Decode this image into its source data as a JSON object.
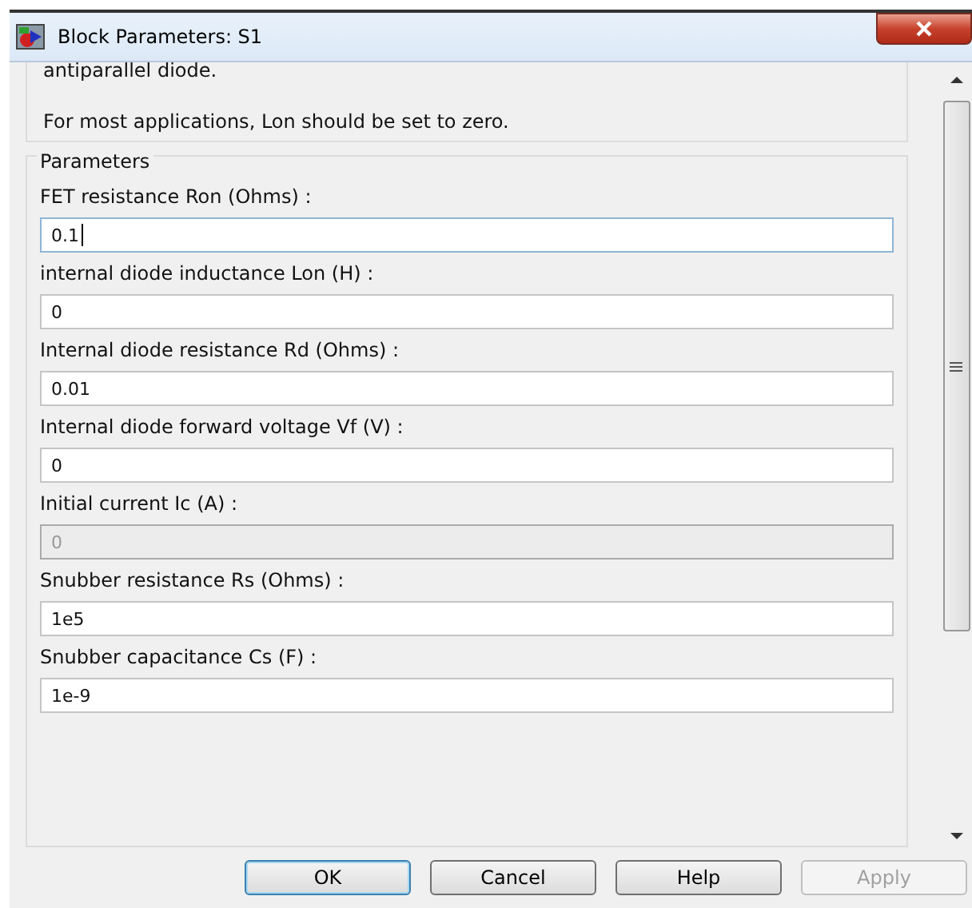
{
  "window": {
    "title": "Block Parameters: S1"
  },
  "description": [
    "antiparallel diode.",
    "For most applications, Lon should be set to zero."
  ],
  "parameters": {
    "title": "Parameters",
    "fields": [
      {
        "label": "FET resistance Ron (Ohms) :",
        "value": "0.1",
        "focused": true,
        "disabled": false
      },
      {
        "label": "internal diode inductance Lon (H) :",
        "value": "0",
        "focused": false,
        "disabled": false
      },
      {
        "label": "Internal diode resistance Rd  (Ohms) :",
        "value": "0.01",
        "focused": false,
        "disabled": false
      },
      {
        "label": "Internal diode forward voltage Vf (V) :",
        "value": "0",
        "focused": false,
        "disabled": false
      },
      {
        "label": "Initial current Ic (A) :",
        "value": "0",
        "focused": false,
        "disabled": true
      },
      {
        "label": "Snubber resistance Rs (Ohms) :",
        "value": "1e5",
        "focused": false,
        "disabled": false
      },
      {
        "label": "Snubber capacitance Cs (F) :",
        "value": "1e-9",
        "focused": false,
        "disabled": false
      }
    ]
  },
  "buttons": [
    {
      "label": "OK",
      "default": true,
      "disabled": false
    },
    {
      "label": "Cancel",
      "default": false,
      "disabled": false
    },
    {
      "label": "Help",
      "default": false,
      "disabled": false
    },
    {
      "label": "Apply",
      "default": false,
      "disabled": true
    }
  ]
}
